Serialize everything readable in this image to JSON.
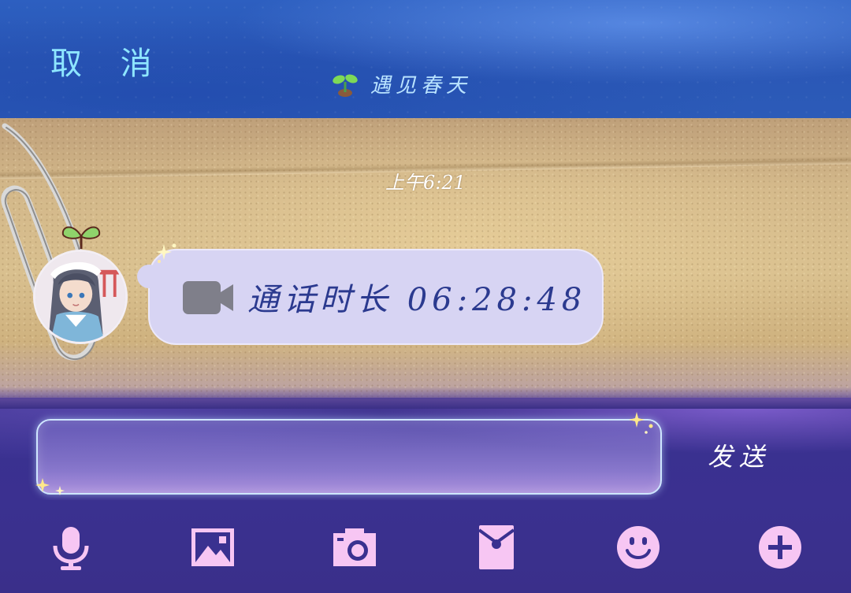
{
  "header": {
    "cancel_label": "取 消",
    "title": "遇见春天"
  },
  "chat": {
    "time_label": "上午6:21",
    "message": {
      "text": "通话时长 06:28:48"
    }
  },
  "input": {
    "value": "",
    "placeholder": "",
    "send_label": "发送"
  },
  "toolbar": {
    "items": [
      {
        "name": "voice",
        "icon": "microphone-icon"
      },
      {
        "name": "image",
        "icon": "image-icon"
      },
      {
        "name": "camera",
        "icon": "camera-icon"
      },
      {
        "name": "red-packet",
        "icon": "red-packet-icon"
      },
      {
        "name": "emoji",
        "icon": "smiley-icon"
      },
      {
        "name": "more",
        "icon": "plus-icon"
      }
    ],
    "icon_color": "#f7c6f3"
  },
  "colors": {
    "header_blue": "#2c5bb8",
    "cancel_text": "#8ee6ff",
    "bubble_bg": "#d7d4f3",
    "bubble_text": "#2b3a8f",
    "input_bar": "#3a3190"
  }
}
